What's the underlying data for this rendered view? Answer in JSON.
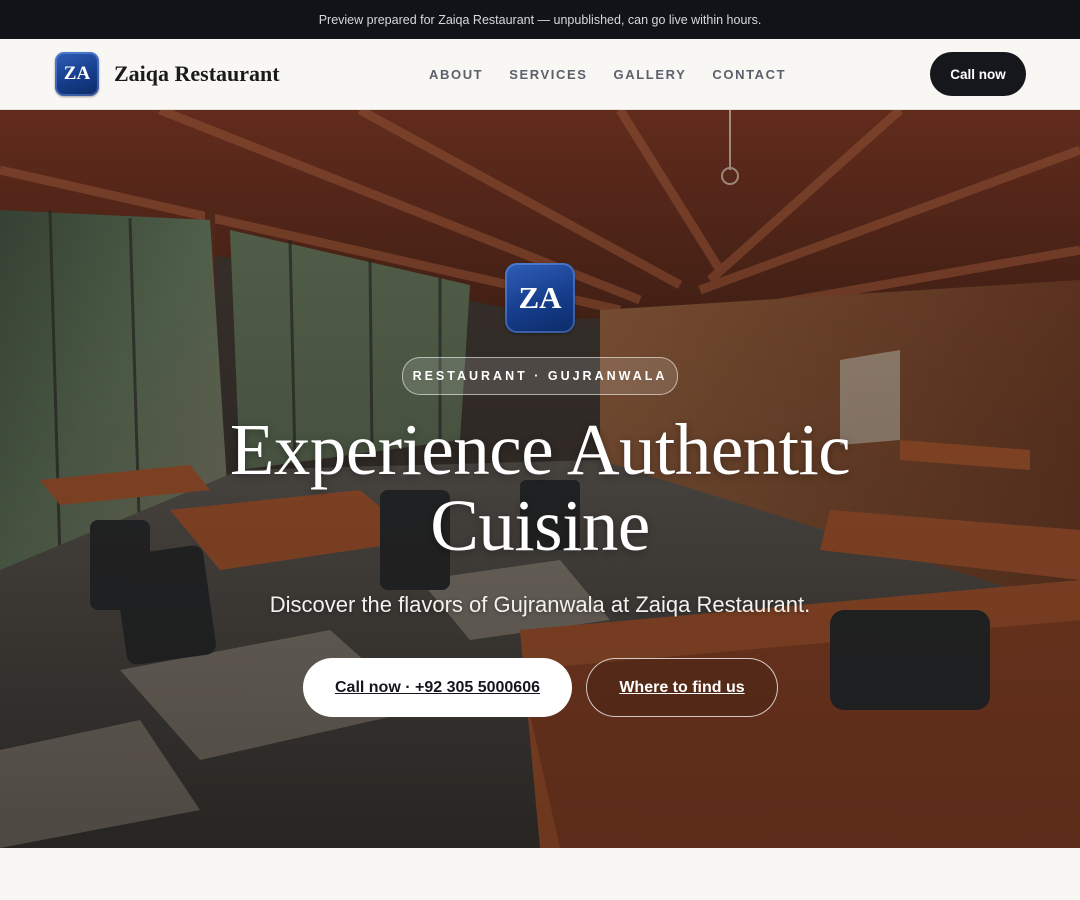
{
  "banner": {
    "text": "Preview prepared for Zaiqa Restaurant — unpublished, can go live within hours."
  },
  "header": {
    "logo_initials": "ZA",
    "brand_name": "Zaiqa Restaurant",
    "nav": [
      {
        "label": "ABOUT"
      },
      {
        "label": "SERVICES"
      },
      {
        "label": "GALLERY"
      },
      {
        "label": "CONTACT"
      }
    ],
    "cta_label": "Call now"
  },
  "hero": {
    "logo_initials": "ZA",
    "eyebrow": "RESTAURANT · GUJRANWALA",
    "headline_line1": "Experience Authentic",
    "headline_line2": "Cuisine",
    "subheadline": "Discover the flavors of Gujranwala at Zaiqa Restaurant.",
    "primary_button": "Call now · +92 305 5000606",
    "secondary_button": "Where to find us",
    "background_image": "restaurant-interior-photo"
  },
  "colors": {
    "banner_bg": "#111318",
    "dark_button": "#15171c",
    "logo_blue": "#1c4596",
    "page_bg": "#f8f7f3"
  }
}
